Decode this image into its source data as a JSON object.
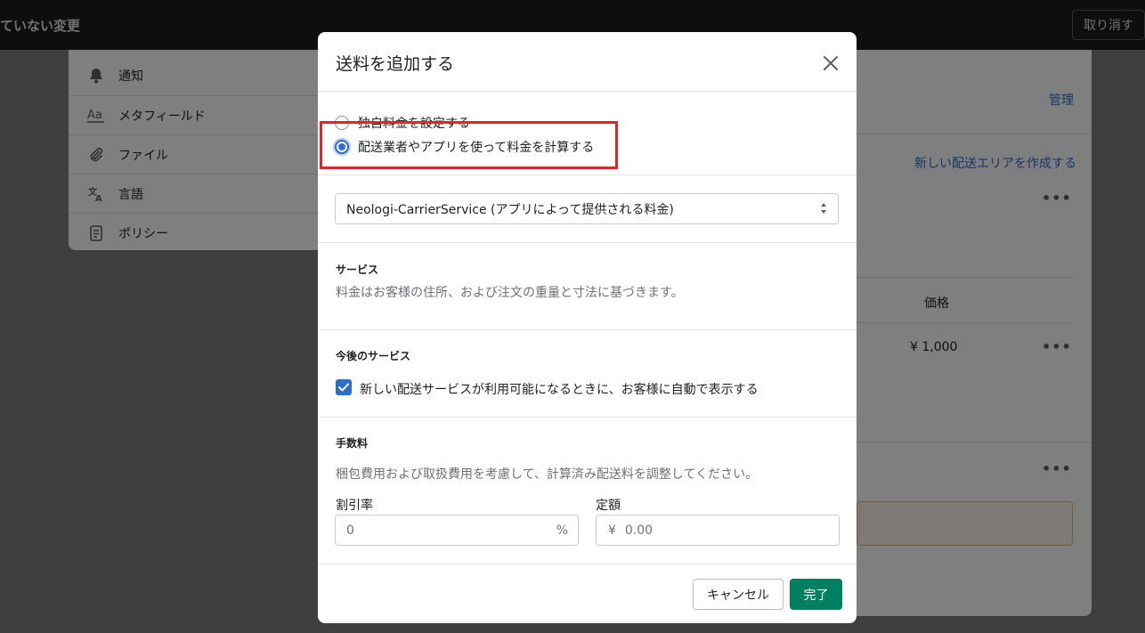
{
  "topbar": {
    "title": "ていない変更",
    "discard_label": "取り消す"
  },
  "sidebar": {
    "items": [
      {
        "label": "通知",
        "icon": "bell-icon"
      },
      {
        "label": "メタフィールド",
        "icon": "metafield-icon"
      },
      {
        "label": "ファイル",
        "icon": "paperclip-icon"
      },
      {
        "label": "言語",
        "icon": "translate-icon"
      },
      {
        "label": "ポリシー",
        "icon": "policy-icon"
      }
    ]
  },
  "background": {
    "manage_link": "管理",
    "create_zone_link": "新しい配送エリアを作成する",
    "price_header": "価格",
    "price_value": "¥ 1,000",
    "more": "•••"
  },
  "modal": {
    "title": "送料を追加する",
    "rate_options": [
      {
        "label": "独自料金を設定する",
        "selected": false
      },
      {
        "label": "配送業者やアプリを使って料金を計算する",
        "selected": true
      }
    ],
    "carrier_select": {
      "value": "Neologi-CarrierService (アプリによって提供される料金)"
    },
    "services": {
      "heading": "サービス",
      "description": "料金はお客様の住所、および注文の重量と寸法に基づきます。"
    },
    "future_services": {
      "heading": "今後のサービス",
      "checkbox_label": "新しい配送サービスが利用可能になるときに、お客様に自動で表示する",
      "checked": true
    },
    "handling_fee": {
      "heading": "手数料",
      "description": "梱包費用および取扱費用を考慮して、計算済み配送料を調整してください。",
      "percent_label": "割引率",
      "percent_placeholder": "0",
      "percent_suffix": "%",
      "flat_label": "定額",
      "flat_prefix": "¥",
      "flat_placeholder": "0.00"
    },
    "cancel_label": "キャンセル",
    "done_label": "完了"
  },
  "colors": {
    "primary": "#008060",
    "accent": "#2c6ecb",
    "highlight": "#e0242c"
  }
}
